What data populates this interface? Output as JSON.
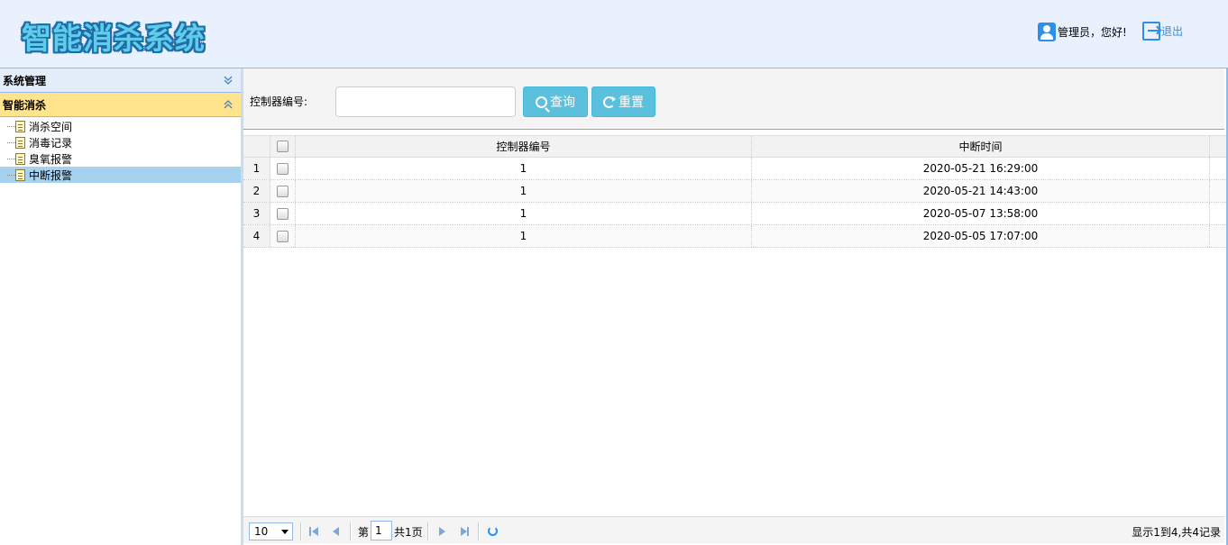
{
  "header": {
    "logo": "智能消杀系统",
    "user_greeting": "管理员，您好!",
    "logout_label": "退出",
    "icons": {
      "user": "user-icon",
      "logout": "logout-icon"
    }
  },
  "sidebar": {
    "panels": [
      {
        "title": "系统管理",
        "state": "collapsed"
      },
      {
        "title": "智能消杀",
        "state": "expanded"
      }
    ],
    "tree": [
      {
        "label": "消杀空间"
      },
      {
        "label": "消毒记录"
      },
      {
        "label": "臭氧报警"
      },
      {
        "label": "中断报警",
        "selected": true
      }
    ]
  },
  "search": {
    "label": "控制器编号:",
    "value": "",
    "placeholder": "",
    "query_label": "查询",
    "reset_label": "重置"
  },
  "grid": {
    "columns": [
      "控制器编号",
      "中断时间"
    ],
    "rows": [
      {
        "n": "1",
        "controller": "1",
        "time": "2020-05-21 16:29:00"
      },
      {
        "n": "2",
        "controller": "1",
        "time": "2020-05-21 14:43:00"
      },
      {
        "n": "3",
        "controller": "1",
        "time": "2020-05-07 13:58:00"
      },
      {
        "n": "4",
        "controller": "1",
        "time": "2020-05-05 17:07:00"
      }
    ]
  },
  "pager": {
    "page_size": "10",
    "page_prefix": "第",
    "page_value": "1",
    "page_total": "共1页",
    "info": "显示1到4,共4记录"
  },
  "colors": {
    "accent": "#5bc0de",
    "header_bg": "#e8f1fd",
    "border": "#95b8e7",
    "selected": "#a6d2f0",
    "active_panel": "#ffe48d"
  }
}
